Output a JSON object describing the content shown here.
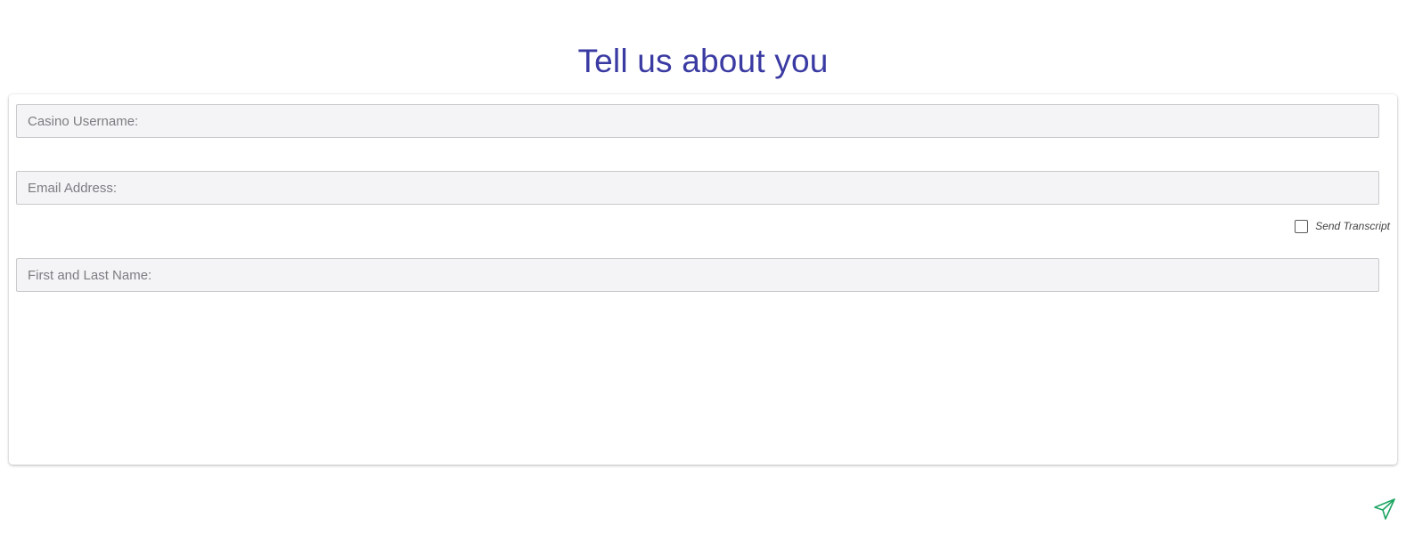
{
  "header": {
    "title": "Tell us about you"
  },
  "form": {
    "username": {
      "placeholder": "Casino Username:",
      "value": ""
    },
    "email": {
      "placeholder": "Email Address:",
      "value": ""
    },
    "send_transcript": {
      "label": "Send Transcript",
      "checked": false
    },
    "name": {
      "placeholder": "First and Last Name:",
      "value": ""
    }
  },
  "actions": {
    "send_icon": "send-paper-plane-icon",
    "send_color": "#1ea562"
  },
  "colors": {
    "title": "#3a3aa3",
    "field_bg": "#f4f4f6",
    "field_border": "#c9c9cc"
  }
}
